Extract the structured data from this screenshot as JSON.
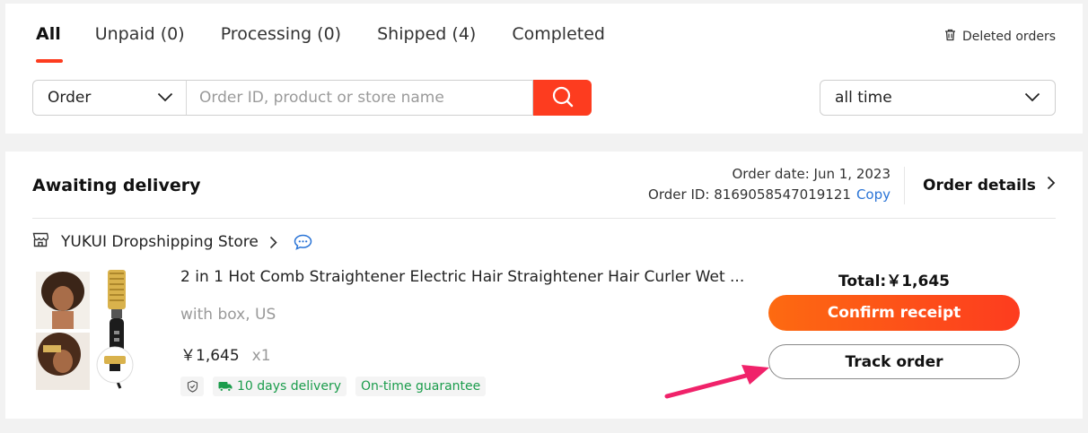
{
  "tabs": [
    {
      "label": "All",
      "active": true
    },
    {
      "label": "Unpaid (0)"
    },
    {
      "label": "Processing (0)"
    },
    {
      "label": "Shipped (4)"
    },
    {
      "label": "Completed"
    }
  ],
  "deleted_orders": {
    "label": "Deleted orders",
    "icon": "trash-icon"
  },
  "search": {
    "type_select": "Order",
    "placeholder": "Order ID, product or store name",
    "button_icon": "search-icon"
  },
  "time_filter": {
    "selected": "all time"
  },
  "order": {
    "status": "Awaiting delivery",
    "order_date": "Order date: Jun 1, 2023",
    "order_id": "Order ID: 8169058547019121",
    "copy_label": "Copy",
    "details_label": "Order details",
    "store": {
      "name": "YUKUI Dropshipping Store",
      "icon": "store-icon",
      "chat_icon": "chat-icon"
    },
    "item": {
      "title": "2 in 1 Hot Comb Straightener Electric Hair Straightener Hair Curler Wet ...",
      "variant": "with box, US",
      "price": "￥1,645",
      "quantity": "x1",
      "tags": [
        "10 days delivery",
        "On-time guarantee"
      ]
    },
    "total": "Total:￥1,645",
    "confirm_label": "Confirm receipt",
    "track_label": "Track order"
  },
  "colors": {
    "accent": "#fd3c1f",
    "accent_gradient_start": "#fd6a11",
    "link": "#2a74d6",
    "tag_green": "#1a9c4b",
    "annotation_arrow": "#f0226a"
  }
}
